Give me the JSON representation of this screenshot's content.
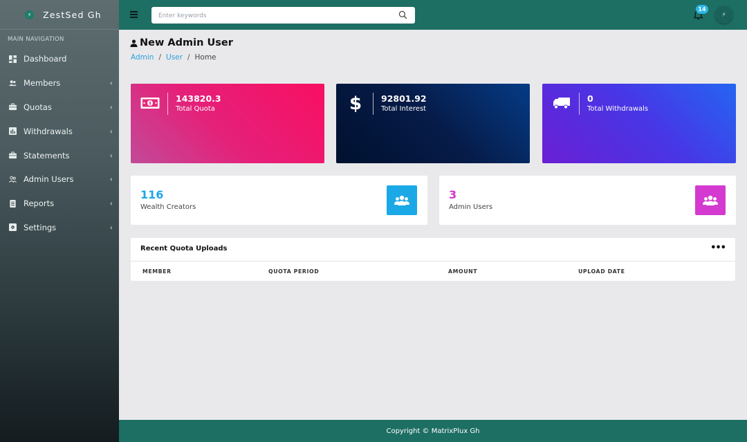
{
  "brand": {
    "name": "ZestSed Gh",
    "logo_glyph": "⚡"
  },
  "sidebar": {
    "heading": "MAIN NAVIGATION",
    "items": [
      {
        "label": "Dashboard",
        "icon": "dashboard-icon",
        "has_chevron": false
      },
      {
        "label": "Members",
        "icon": "users-icon",
        "has_chevron": true
      },
      {
        "label": "Quotas",
        "icon": "briefcase-icon",
        "has_chevron": true
      },
      {
        "label": "Withdrawals",
        "icon": "chart-icon",
        "has_chevron": true
      },
      {
        "label": "Statements",
        "icon": "briefcase-icon",
        "has_chevron": true
      },
      {
        "label": "Admin Users",
        "icon": "user-group-icon",
        "has_chevron": true
      },
      {
        "label": "Reports",
        "icon": "report-icon",
        "has_chevron": true
      },
      {
        "label": "Settings",
        "icon": "settings-icon",
        "has_chevron": true
      }
    ],
    "chevron": "‹"
  },
  "topbar": {
    "search_placeholder": "Enter keywords",
    "notification_count": "14",
    "avatar_glyph": "⚡"
  },
  "page": {
    "title": "New Admin User",
    "breadcrumb": [
      "Admin",
      "User",
      "Home"
    ],
    "breadcrumb_sep": "/"
  },
  "stats": [
    {
      "value": "143820.3",
      "label": "Total Quota",
      "icon": "money-icon"
    },
    {
      "value": "92801.92",
      "label": "Total Interest",
      "icon": "dollar-icon"
    },
    {
      "value": "0",
      "label": "Total Withdrawals",
      "icon": "truck-icon"
    }
  ],
  "info_cards": [
    {
      "value": "116",
      "label": "Wealth Creators",
      "value_color": "#1fa7e8",
      "button_color": "#1aa9e6",
      "icon": "group-icon"
    },
    {
      "value": "3",
      "label": "Admin Users",
      "value_color": "#d036c9",
      "button_color": "#d43ad0",
      "icon": "group-icon"
    }
  ],
  "recent_uploads": {
    "title": "Recent Quota Uploads",
    "more": "•••",
    "columns": [
      "MEMBER",
      "QUOTA PERIOD",
      "AMOUNT",
      "UPLOAD DATE"
    ]
  },
  "footer": {
    "text": "Copyright © MatrixPlux Gh"
  }
}
